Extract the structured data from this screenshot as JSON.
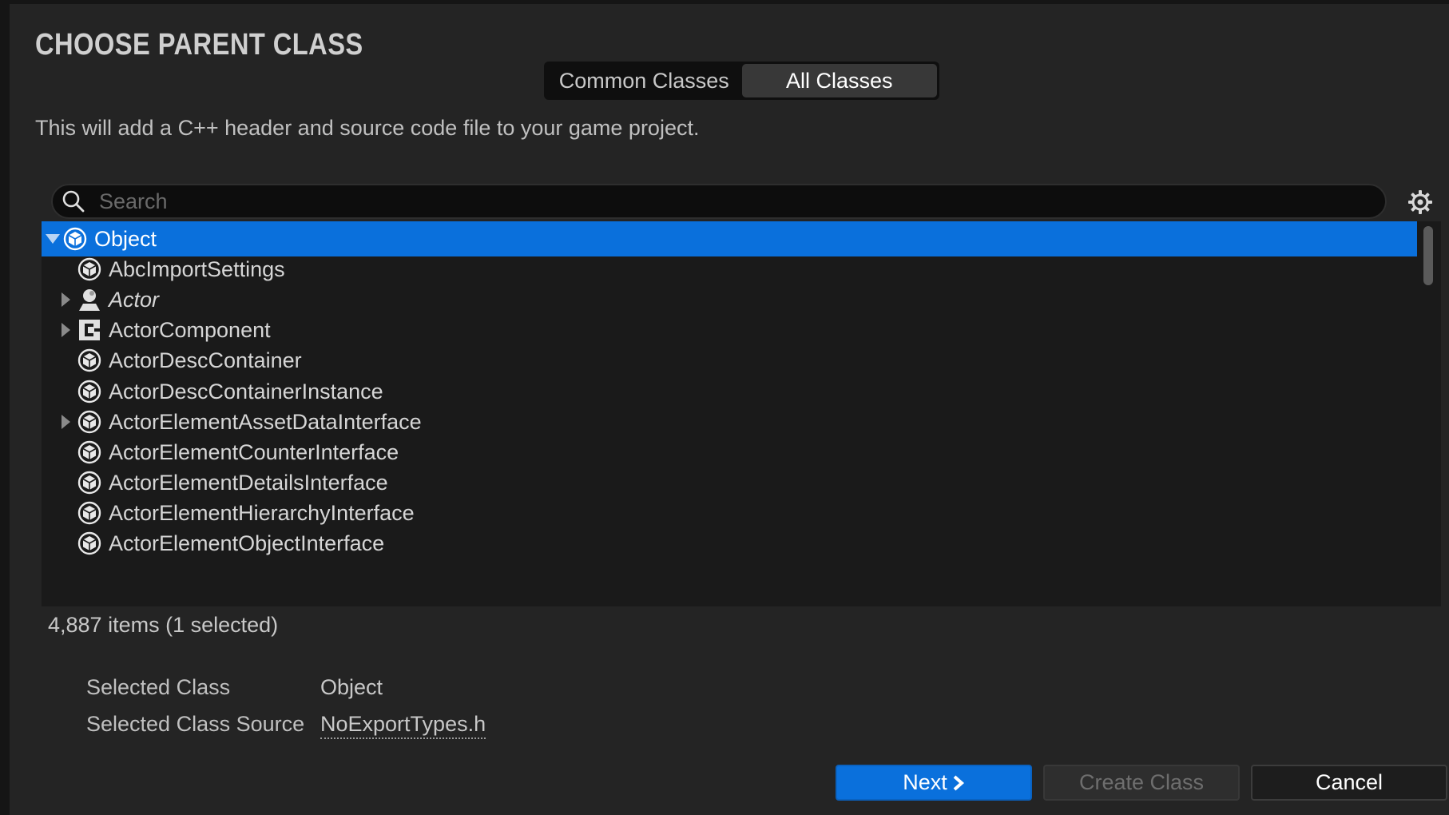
{
  "dialog": {
    "title": "CHOOSE PARENT CLASS",
    "description": "This will add a C++ header and source code file to your game project."
  },
  "tabs": [
    {
      "label": "Common Classes",
      "active": false
    },
    {
      "label": "All Classes",
      "active": true
    }
  ],
  "search": {
    "placeholder": "Search",
    "value": ""
  },
  "tree": {
    "items": [
      {
        "label": "Object",
        "icon": "object-class-icon",
        "expanded": true,
        "has_children": true,
        "selected": true,
        "italic": false,
        "depth": 0
      },
      {
        "label": "AbcImportSettings",
        "icon": "object-class-icon",
        "has_children": false,
        "italic": false,
        "depth": 1
      },
      {
        "label": "Actor",
        "icon": "actor-icon",
        "has_children": true,
        "italic": true,
        "depth": 1
      },
      {
        "label": "ActorComponent",
        "icon": "component-icon",
        "has_children": true,
        "italic": false,
        "depth": 1
      },
      {
        "label": "ActorDescContainer",
        "icon": "object-class-icon",
        "has_children": false,
        "italic": false,
        "depth": 1
      },
      {
        "label": "ActorDescContainerInstance",
        "icon": "object-class-icon",
        "has_children": false,
        "italic": false,
        "depth": 1
      },
      {
        "label": "ActorElementAssetDataInterface",
        "icon": "object-class-icon",
        "has_children": true,
        "italic": false,
        "depth": 1
      },
      {
        "label": "ActorElementCounterInterface",
        "icon": "object-class-icon",
        "has_children": false,
        "italic": false,
        "depth": 1
      },
      {
        "label": "ActorElementDetailsInterface",
        "icon": "object-class-icon",
        "has_children": false,
        "italic": false,
        "depth": 1
      },
      {
        "label": "ActorElementHierarchyInterface",
        "icon": "object-class-icon",
        "has_children": false,
        "italic": false,
        "depth": 1
      },
      {
        "label": "ActorElementObjectInterface",
        "icon": "object-class-icon",
        "has_children": false,
        "italic": false,
        "depth": 1
      }
    ],
    "count_text": "4,887 items (1 selected)"
  },
  "selection": {
    "class_label": "Selected Class",
    "class_value": "Object",
    "source_label": "Selected Class Source",
    "source_value": "NoExportTypes.h"
  },
  "buttons": {
    "next": "Next",
    "create": "Create Class",
    "cancel": "Cancel"
  },
  "colors": {
    "accent": "#0a70dc",
    "background": "#242424",
    "tree_background": "#1a1a1a"
  }
}
